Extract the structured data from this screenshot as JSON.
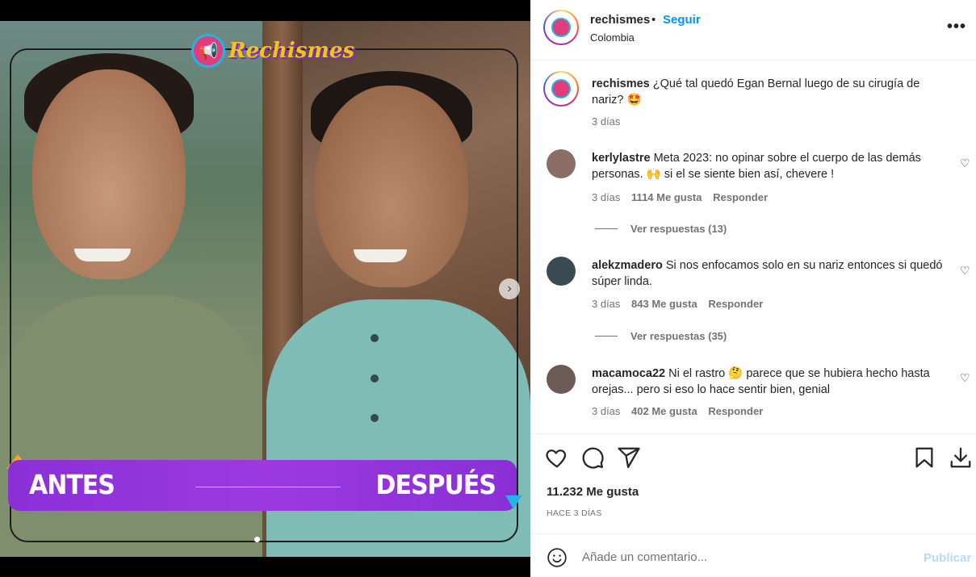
{
  "post_image": {
    "logo_text": "Rechismes",
    "before_label": "ANTES",
    "after_label": "DESPUÉS"
  },
  "header": {
    "username": "rechismes",
    "separator": "•",
    "follow_label": "Seguir",
    "location": "Colombia",
    "more_label": "•••"
  },
  "caption": {
    "username": "rechismes",
    "text": "¿Qué tal quedó Egan Bernal luego de su cirugía de nariz? 🤩",
    "time": "3 días"
  },
  "comments": [
    {
      "username": "kerlylastre",
      "text": "Meta 2023: no opinar sobre el cuerpo de las demás personas. 🙌 si el se siente bien así, chevere !",
      "time": "3 días",
      "likes": "1114 Me gusta",
      "reply_label": "Responder",
      "view_replies": "Ver respuestas (13)",
      "avatar_color": "#8a6e66"
    },
    {
      "username": "alekzmadero",
      "text": "Si nos enfocamos solo en su nariz entonces si quedó súper linda.",
      "time": "3 días",
      "likes": "843 Me gusta",
      "reply_label": "Responder",
      "view_replies": "Ver respuestas (35)",
      "avatar_color": "#3a4a52"
    },
    {
      "username": "macamoca22",
      "text": "Ni el rastro 🤔 parece que se hubiera hecho hasta orejas... pero si eso lo hace sentir bien, genial",
      "time": "3 días",
      "likes": "402 Me gusta",
      "reply_label": "Responder",
      "avatar_color": "#6b5a55"
    }
  ],
  "actions": {
    "likes_count": "11.232 Me gusta",
    "posted_ago": "HACE 3 DÍAS"
  },
  "add_comment": {
    "placeholder": "Añade un comentario...",
    "publish_label": "Publicar"
  },
  "colors": {
    "accent": "#0095f6",
    "publish_disabled": "#b3dbff",
    "banner_purple": "#9c3ae0"
  }
}
